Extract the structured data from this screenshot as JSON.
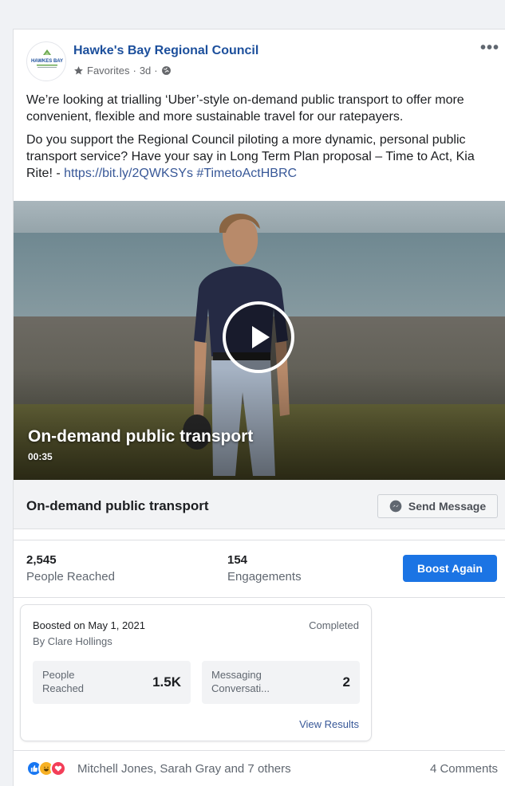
{
  "post": {
    "page_name": "Hawke's Bay Regional Council",
    "avatar_text": "HAWKES BAY",
    "favorites_label": "Favorites",
    "time": "3d",
    "more_label": "•••",
    "paragraph1": "We’re looking at trialling ‘Uber’-style on-demand public transport to offer more convenient, flexible and more sustainable travel for our ratepayers.",
    "paragraph2_text": "Do you support the Regional Council piloting a more dynamic, personal public transport service? Have your say in Long Term Plan proposal – Time to Act, Kia Rite! - ",
    "link_url": "https://bit.ly/2QWKSYs",
    "hashtag": "#TimetoActHBRC"
  },
  "video": {
    "title": "On-demand public transport",
    "duration": "00:35"
  },
  "cta": {
    "title": "On-demand public transport",
    "send_button": "Send Message"
  },
  "stats": {
    "reached_value": "2,545",
    "reached_label": "People Reached",
    "engagements_value": "154",
    "engagements_label": "Engagements",
    "boost_button": "Boost Again"
  },
  "boost": {
    "date": "Boosted on May 1, 2021",
    "by": "By Clare Hollings",
    "status": "Completed",
    "metric1_label": "People Reached",
    "metric1_value": "1.5K",
    "metric2_label": "Messaging Conversati...",
    "metric2_value": "2",
    "view_results": "View Results"
  },
  "reactions": {
    "names": "Mitchell Jones, Sarah Gray and 7 others",
    "comments": "4 Comments",
    "colors": {
      "like": "#1877f2",
      "haha": "#f7b125",
      "love": "#f33e58"
    }
  }
}
